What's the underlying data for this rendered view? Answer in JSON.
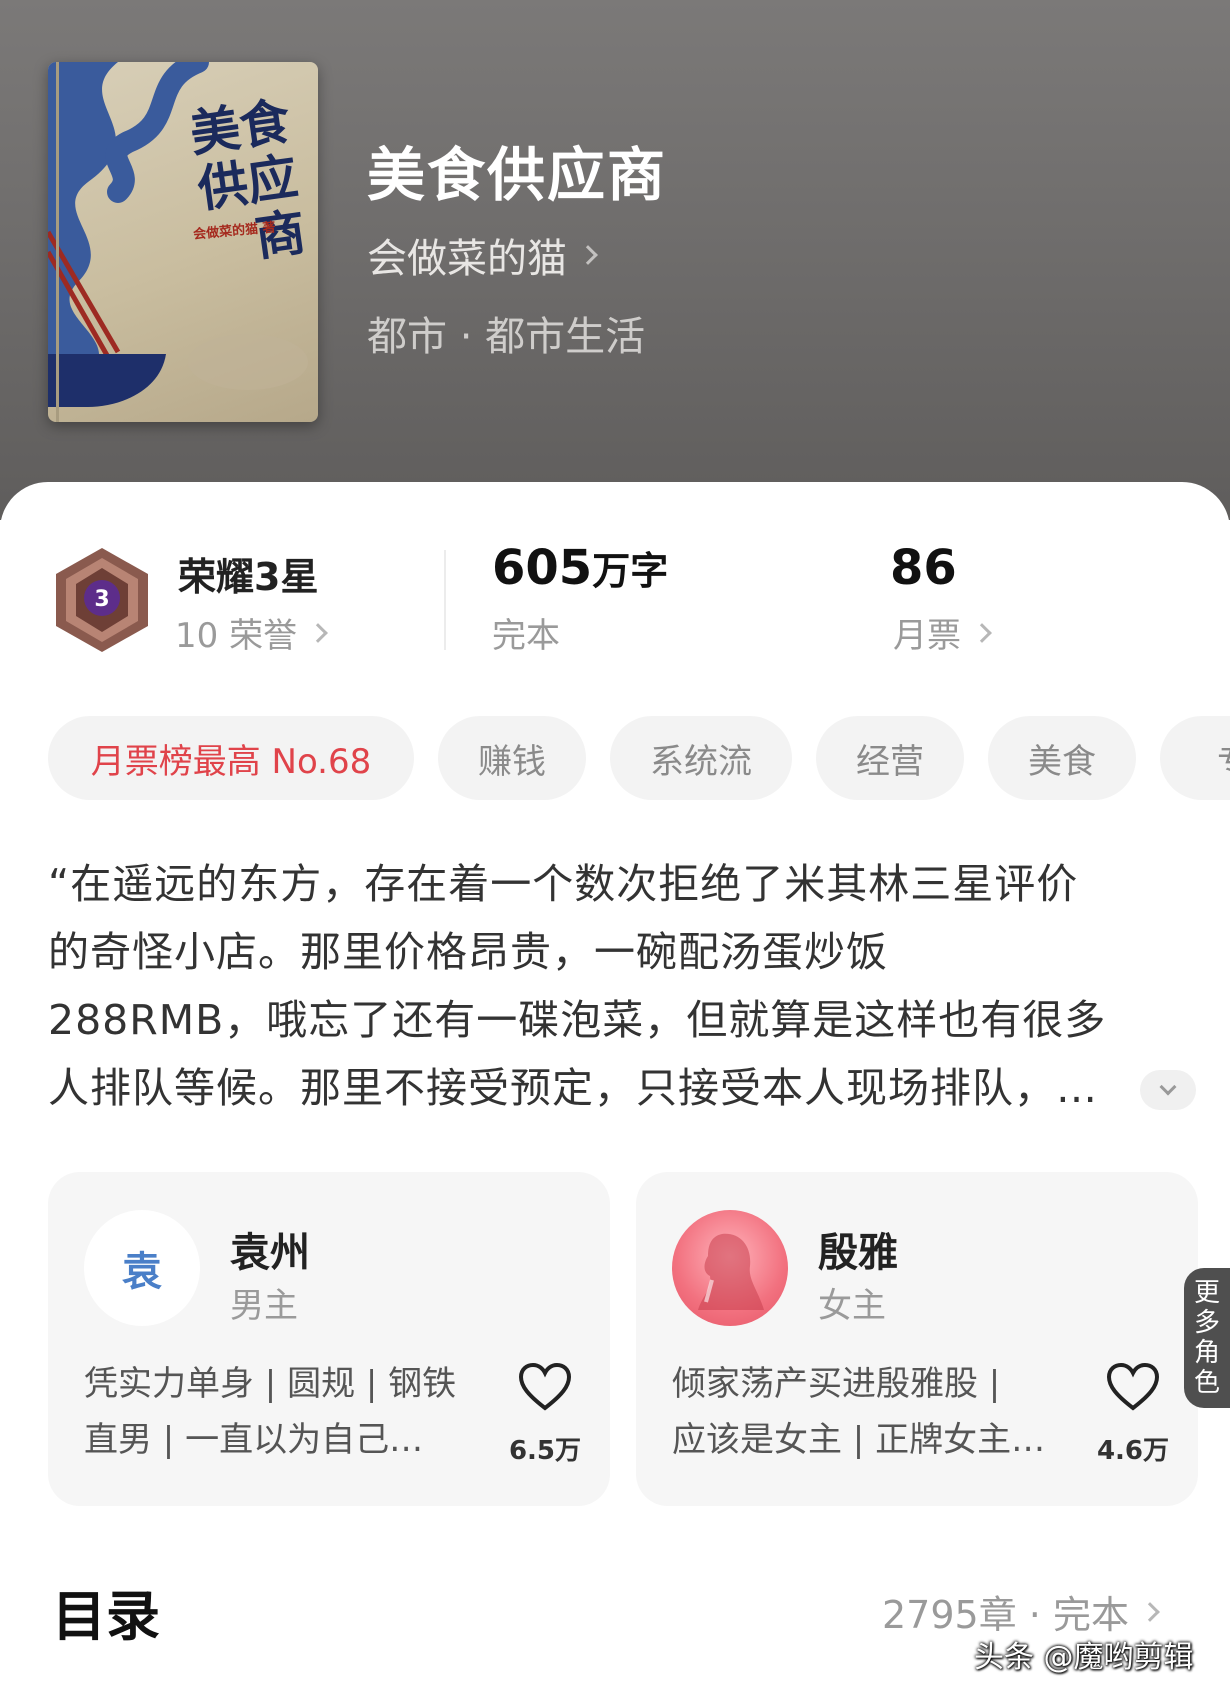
{
  "book": {
    "cover_title": "美食供应商",
    "cover_author": "会做菜的猫 著",
    "title": "美食供应商",
    "author": "会做菜的猫",
    "genre": "都市 · 都市生活"
  },
  "stats": {
    "honor_title": "荣耀3星",
    "honor_level": "3",
    "honor_count": "10 荣誉",
    "word_count": "605",
    "word_unit": "万字",
    "status": "完本",
    "monthly_votes": "86",
    "monthly_votes_label": "月票"
  },
  "tags": [
    "月票榜最高 No.68",
    "赚钱",
    "系统流",
    "经营",
    "美食",
    "专"
  ],
  "synopsis": {
    "lines": [
      "“在遥远的东方，存在着一个数次拒绝了米其林三星评价",
      "的奇怪小店。那里价格昂贵，一碗配汤蛋炒饭",
      "288RMB，哦忘了还有一碟泡菜，但就算是这样也有很多",
      "人排队等候。那里不接受预定，只接受本人现场排队，…"
    ]
  },
  "characters": [
    {
      "avatar_text": "袁",
      "name": "袁州",
      "role": "男主",
      "desc_lines": [
        "凭实力单身 | 圆规 | 钢铁",
        "直男 | 一直以为自己…"
      ],
      "likes": "6.5万"
    },
    {
      "avatar_text": "",
      "name": "殷雅",
      "role": "女主",
      "desc_lines": [
        "倾家荡产买进殷雅股 |",
        "应该是女主 | 正牌女主…"
      ],
      "likes": "4.6万"
    }
  ],
  "more_roles": [
    "更",
    "多",
    "角",
    "色"
  ],
  "toc": {
    "title": "目录",
    "meta": "2795章 · 完本"
  },
  "watermark": "头条 @魔哟剪辑",
  "colors": {
    "header_bg": "#6f6d6c",
    "hot_tag": "#e0434a",
    "avatar_text": "#4a7fc8"
  }
}
